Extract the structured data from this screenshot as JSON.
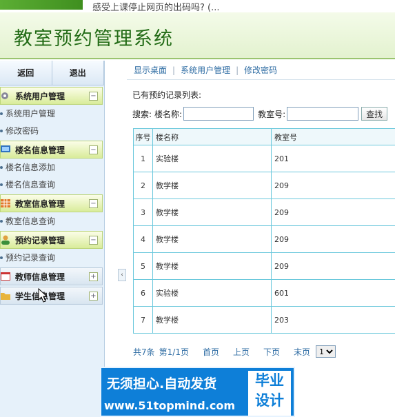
{
  "topbar": {
    "text": "感受上课停止网页的出码吗?  (..."
  },
  "banner": {
    "title": "教室预约管理系统"
  },
  "sidebar": {
    "back_label": "返回",
    "logout_label": "退出",
    "sections": [
      {
        "label": "系统用户管理",
        "state": "expanded",
        "icon": "gear-icon",
        "items": [
          "系统用户管理",
          "修改密码"
        ]
      },
      {
        "label": "楼名信息管理",
        "state": "expanded",
        "icon": "monitor-icon",
        "items": [
          "楼名信息添加",
          "楼名信息查询"
        ]
      },
      {
        "label": "教室信息管理",
        "state": "expanded",
        "icon": "grid-icon",
        "items": [
          "教室信息查询"
        ]
      },
      {
        "label": "预约记录管理",
        "state": "expanded",
        "icon": "user-icon",
        "items": [
          "预约记录查询"
        ]
      },
      {
        "label": "教师信息管理",
        "state": "collapsed",
        "icon": "calendar-icon",
        "items": []
      },
      {
        "label": "学生信息管理",
        "state": "collapsed",
        "icon": "folder-icon",
        "items": []
      }
    ]
  },
  "nav": {
    "items": [
      "显示桌面",
      "系统用户管理",
      "修改密码"
    ]
  },
  "main": {
    "caption": "已有预约记录列表:",
    "search": {
      "prefix": "搜索:",
      "building_label": "楼名称:",
      "room_label": "教室号:",
      "button_label": "查找",
      "building_value": "",
      "room_value": ""
    },
    "table": {
      "columns": [
        "序号",
        "楼名称",
        "教室号"
      ],
      "rows": [
        [
          "1",
          "实验楼",
          "201"
        ],
        [
          "2",
          "教学楼",
          "209"
        ],
        [
          "3",
          "教学楼",
          "209"
        ],
        [
          "4",
          "教学楼",
          "209"
        ],
        [
          "5",
          "教学楼",
          "209"
        ],
        [
          "6",
          "实验楼",
          "601"
        ],
        [
          "7",
          "教学楼",
          "203"
        ]
      ]
    },
    "pager": {
      "total": "共7条",
      "page_info": "第1/1页",
      "first": "首页",
      "prev": "上页",
      "next": "下页",
      "last": "末页",
      "selected_page": "1"
    }
  },
  "watermark": {
    "line1": "无须担心.自动发货",
    "line2": "www.51topmind.com",
    "badge1": "毕业",
    "badge2": "设计"
  },
  "colors": {
    "accent_green": "#226b16",
    "link_blue": "#2e6ca3",
    "table_border": "#6bc8dc"
  }
}
